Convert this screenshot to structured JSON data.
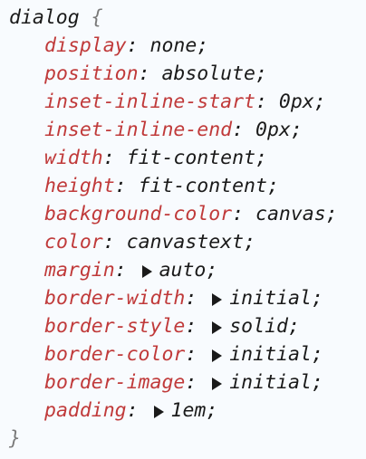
{
  "rule": {
    "selector": "dialog",
    "open_brace": "{",
    "close_brace": "}",
    "declarations": [
      {
        "property": "display",
        "value": "none",
        "expandable": false
      },
      {
        "property": "position",
        "value": "absolute",
        "expandable": false
      },
      {
        "property": "inset-inline-start",
        "value": "0px",
        "expandable": false
      },
      {
        "property": "inset-inline-end",
        "value": "0px",
        "expandable": false
      },
      {
        "property": "width",
        "value": "fit-content",
        "expandable": false
      },
      {
        "property": "height",
        "value": "fit-content",
        "expandable": false
      },
      {
        "property": "background-color",
        "value": "canvas",
        "expandable": false
      },
      {
        "property": "color",
        "value": "canvastext",
        "expandable": false
      },
      {
        "property": "margin",
        "value": "auto",
        "expandable": true
      },
      {
        "property": "border-width",
        "value": "initial",
        "expandable": true
      },
      {
        "property": "border-style",
        "value": "solid",
        "expandable": true
      },
      {
        "property": "border-color",
        "value": "initial",
        "expandable": true
      },
      {
        "property": "border-image",
        "value": "initial",
        "expandable": true
      },
      {
        "property": "padding",
        "value": "1em",
        "expandable": true
      }
    ]
  },
  "colors": {
    "background": "#f8fbfe",
    "property_name": "#c03a3a",
    "value": "#1a1a1a",
    "brace": "#7a7a7a"
  },
  "icons": {
    "expander": "triangle-right-icon"
  }
}
